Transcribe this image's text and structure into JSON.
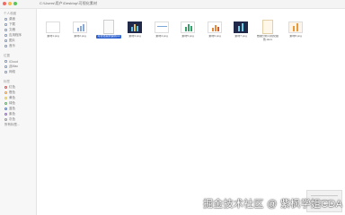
{
  "window": {
    "path_title": "C:\\Users\\用户\\Desktop\\可视化素材"
  },
  "sidebar": {
    "sections": [
      {
        "heading": "个人收藏",
        "items": [
          "桌面",
          "下载",
          "文稿",
          "应用程序",
          "图片",
          "音乐"
        ]
      },
      {
        "heading": "位置",
        "items": [
          "iCloud",
          "此Mac",
          "网络"
        ]
      },
      {
        "heading": "标签",
        "items": [
          "红色",
          "橙色",
          "黄色",
          "绿色",
          "蓝色",
          "紫色",
          "灰色",
          "所有标签…"
        ]
      }
    ]
  },
  "files": [
    {
      "name": "素材1.png",
      "kind": "white",
      "selected": false
    },
    {
      "name": "素材2.png",
      "kind": "chart-light",
      "selected": false
    },
    {
      "name": "可视化案例说明.txt",
      "kind": "document",
      "selected": true
    },
    {
      "name": "素材3.png",
      "kind": "chart-dark",
      "selected": false
    },
    {
      "name": "素材4.png",
      "kind": "line-light",
      "selected": false
    },
    {
      "name": "素材5.png",
      "kind": "bars-green",
      "selected": false
    },
    {
      "name": "素材6.png",
      "kind": "bars-orange",
      "selected": false
    },
    {
      "name": "素材7.png",
      "kind": "chart-dark2",
      "selected": false
    },
    {
      "name": "数据分析可视化报告.docx",
      "kind": "document-beige",
      "selected": false
    },
    {
      "name": "素材8.png",
      "kind": "orange-chart",
      "selected": false
    }
  ],
  "colors": {
    "selection": "#2f62cf",
    "sidebar_bg": "#f7f7f7",
    "dark_thumb": "#20294a"
  },
  "watermark": "掘金技术社区 @ 紫枫学姐CDA"
}
